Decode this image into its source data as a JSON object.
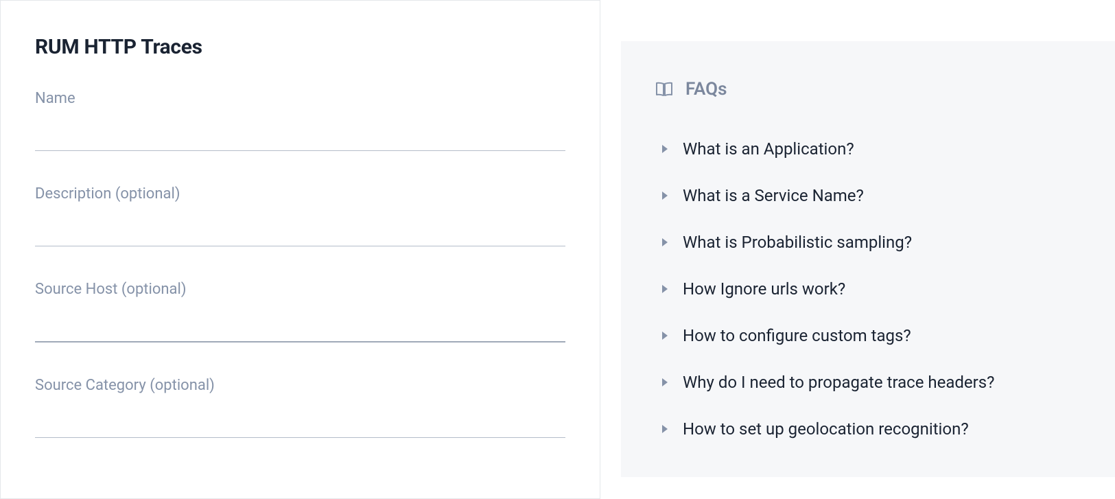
{
  "form": {
    "title": "RUM HTTP Traces",
    "fields": [
      {
        "label": "Name",
        "value": ""
      },
      {
        "label": "Description (optional)",
        "value": ""
      },
      {
        "label": "Source Host (optional)",
        "value": ""
      },
      {
        "label": "Source Category (optional)",
        "value": ""
      }
    ]
  },
  "faqs": {
    "title": "FAQs",
    "items": [
      "What is an Application?",
      "What is a Service Name?",
      "What is Probabilistic sampling?",
      "How Ignore urls work?",
      "How to configure custom tags?",
      "Why do I need to propagate trace headers?",
      "How to set up geolocation recognition?"
    ]
  }
}
